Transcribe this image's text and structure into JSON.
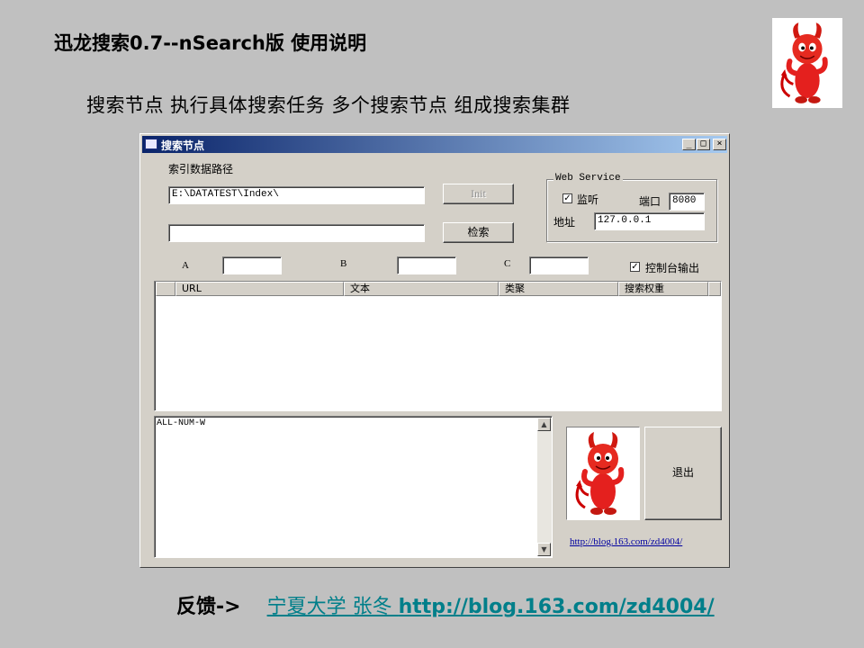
{
  "slide": {
    "title": "迅龙搜索0.7--nSearch版  使用说明",
    "subtitle": "搜索节点   执行具体搜索任务    多个搜索节点 组成搜索集群",
    "footer_label": "反馈->",
    "footer_author": "宁夏大学 张冬 ",
    "footer_url": "http://blog.163.com/zd4004/"
  },
  "window": {
    "title": "搜索节点",
    "min_glyph": "_",
    "max_glyph": "□",
    "close_glyph": "×"
  },
  "form": {
    "index_path_label": "索引数据路径",
    "index_path_value": "E:\\DATATEST\\Index\\",
    "query_value": "",
    "init_button": "Init",
    "search_button": "检索",
    "label_a": "A",
    "label_b": "B",
    "label_c": "C",
    "value_a": "",
    "value_b": "",
    "value_c": "",
    "console_output_label": "控制台输出",
    "console_output_checked": true
  },
  "web_service": {
    "legend": "Web Service",
    "listen_label": "监听",
    "listen_checked": true,
    "port_label": "端口",
    "port_value": "8080",
    "address_label": "地址",
    "address_value": "127.0.0.1"
  },
  "results_table": {
    "columns": [
      "URL",
      "文本",
      "类聚",
      "搜索权重"
    ],
    "rows": []
  },
  "log": {
    "text": "ALL-NUM-W"
  },
  "exit_button": "退出",
  "blog_link": "http://blog.163.com/zd4004/",
  "colors": {
    "titlebar_start": "#0a246a",
    "titlebar_end": "#a6caf0",
    "footer_link": "#007f8a",
    "dialog_face": "#d4d0c8",
    "background": "#c0c0c0"
  },
  "icons": [
    "devil-mascot-icon",
    "app-icon",
    "check-icon",
    "scroll-up-icon",
    "scroll-down-icon"
  ]
}
